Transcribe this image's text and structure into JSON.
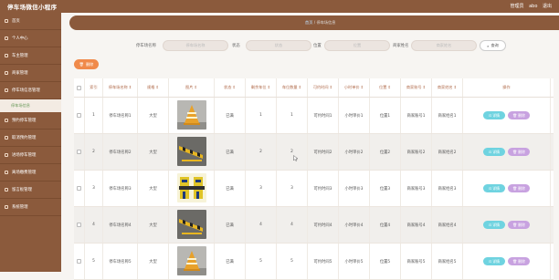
{
  "app": {
    "title": "停车场微信小程序",
    "user_role": "管理员",
    "user_name": "abo",
    "logout": "退出"
  },
  "sidebar": {
    "items": [
      {
        "label": "首页"
      },
      {
        "label": "个人中心"
      },
      {
        "label": "车主管理"
      },
      {
        "label": "商家管理"
      },
      {
        "label": "停车场信息管理"
      },
      {
        "label": "停车场信息",
        "sub": true
      },
      {
        "label": "预约停车管理"
      },
      {
        "label": "取消预约管理"
      },
      {
        "label": "进场停车管理"
      },
      {
        "label": "离场缴费管理"
      },
      {
        "label": "留言板管理"
      },
      {
        "label": "系统管理"
      }
    ]
  },
  "breadcrumb": {
    "home": "首页",
    "sep": "/",
    "current": "停车场信息"
  },
  "filters": {
    "name_label": "停车场名称",
    "name_placeholder": "停车场名称",
    "status_label": "状态",
    "status_placeholder": "状态",
    "location_label": "位置",
    "location_placeholder": "位置",
    "merchant_label": "商家姓名",
    "merchant_placeholder": "商家姓名",
    "search": "查询"
  },
  "toolbar": {
    "delete": "删除"
  },
  "table": {
    "headers": [
      "索引",
      "停车场名称",
      "规格",
      "图片",
      "状态",
      "剩余车位",
      "车位数量",
      "可约时间",
      "小时单价",
      "位置",
      "商家账号",
      "商家姓名",
      "操作"
    ],
    "sort_marks": [
      "",
      "⇕",
      "⇕",
      "⇕",
      "⇕",
      "⇕",
      "⇕",
      "⇕",
      "⇕",
      "⇕",
      "⇕",
      "⇕",
      ""
    ],
    "rows": [
      {
        "idx": "1",
        "name": "停车场名称1",
        "spec": "大型",
        "status": "已满",
        "free": "1",
        "total": "1",
        "time": "可约时间1",
        "price": "小时单价1",
        "loc": "位置1",
        "acct": "商家账号1",
        "merchant": "商家姓名1",
        "img": "cone"
      },
      {
        "idx": "2",
        "name": "停车场名称2",
        "spec": "大型",
        "status": "已满",
        "free": "2",
        "total": "2",
        "time": "可约时间2",
        "price": "小时单价2",
        "loc": "位置2",
        "acct": "商家账号2",
        "merchant": "商家姓名2",
        "img": "barrier"
      },
      {
        "idx": "3",
        "name": "停车场名称3",
        "spec": "大型",
        "status": "已满",
        "free": "3",
        "total": "3",
        "time": "可约时间3",
        "price": "小时单价3",
        "loc": "位置3",
        "acct": "商家账号3",
        "merchant": "商家姓名3",
        "img": "sign"
      },
      {
        "idx": "4",
        "name": "停车场名称4",
        "spec": "大型",
        "status": "已满",
        "free": "4",
        "total": "4",
        "time": "可约时间4",
        "price": "小时单价4",
        "loc": "位置4",
        "acct": "商家账号4",
        "merchant": "商家姓名4",
        "img": "barrier"
      },
      {
        "idx": "5",
        "name": "停车场名称5",
        "spec": "大型",
        "status": "已满",
        "free": "5",
        "total": "5",
        "time": "可约时间5",
        "price": "小时单价5",
        "loc": "位置5",
        "acct": "商家账号5",
        "merchant": "商家姓名5",
        "img": "cone"
      }
    ],
    "detail_label": "详情",
    "delete_label": "删除"
  },
  "colors": {
    "brand": "#8b5a3c",
    "detail": "#6fd3e0",
    "delete": "#c8a2e0",
    "orange": "#f08a4b"
  }
}
